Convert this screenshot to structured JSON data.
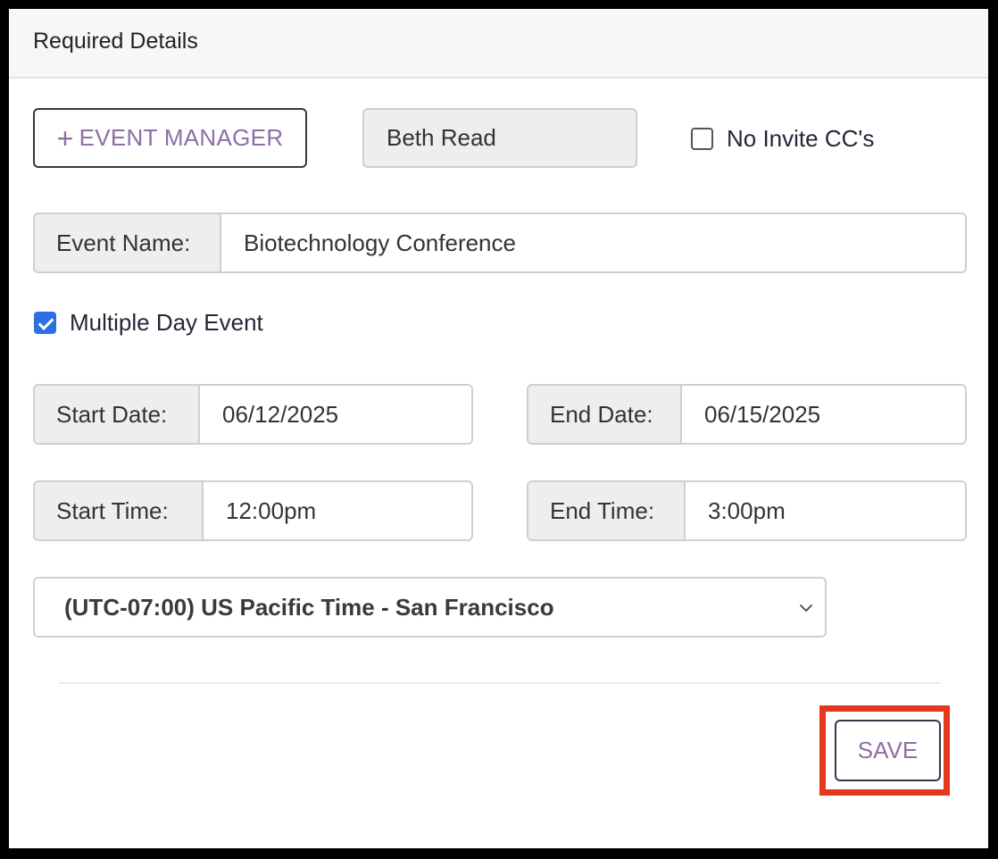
{
  "header": {
    "title": "Required Details"
  },
  "manager": {
    "add_button_label": "EVENT MANAGER",
    "add_button_icon": "plus-icon",
    "current_manager": "Beth Read",
    "no_cc_label": "No Invite CC's",
    "no_cc_checked": false
  },
  "event": {
    "name_label": "Event Name:",
    "name_value": "Biotechnology Conference",
    "multiple_day_label": "Multiple Day Event",
    "multiple_day_checked": true
  },
  "dates": {
    "start_date_label": "Start Date:",
    "start_date_value": "06/12/2025",
    "end_date_label": "End Date:",
    "end_date_value": "06/15/2025",
    "start_time_label": "Start Time:",
    "start_time_value": "12:00pm",
    "end_time_label": "End Time:",
    "end_time_value": "3:00pm"
  },
  "timezone": {
    "selected": "(UTC-07:00) US Pacific Time - San Francisco",
    "chevron_icon": "chevron-down-icon"
  },
  "footer": {
    "save_label": "SAVE",
    "highlight_color": "#e5371d"
  },
  "colors": {
    "accent_text": "#8e6fa8",
    "checkbox_checked": "#2f6fe4",
    "button_border": "#3b3346"
  }
}
